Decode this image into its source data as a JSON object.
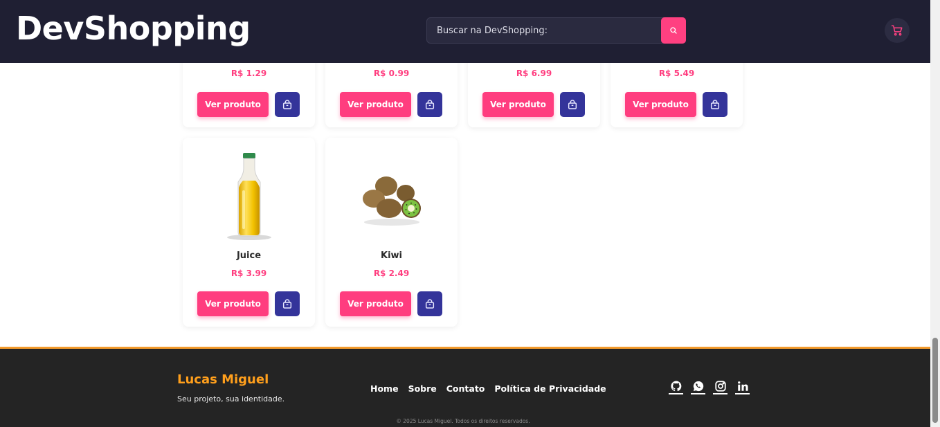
{
  "header": {
    "brand": "DevShopping",
    "search_placeholder": "Buscar na DevShopping:",
    "colors": {
      "bg": "#1f1f33",
      "accent": "#ff4081"
    }
  },
  "products_top_row": [
    {
      "price": "R$ 1.29",
      "view_label": "Ver produto"
    },
    {
      "price": "R$ 0.99",
      "view_label": "Ver produto"
    },
    {
      "price": "R$ 6.99",
      "view_label": "Ver produto"
    },
    {
      "price": "R$ 5.49",
      "view_label": "Ver produto"
    }
  ],
  "products": [
    {
      "name": "Juice",
      "price": "R$ 3.99",
      "view_label": "Ver produto",
      "image": "juice-bottle"
    },
    {
      "name": "Kiwi",
      "price": "R$ 2.49",
      "view_label": "Ver produto",
      "image": "kiwi-fruits"
    }
  ],
  "footer": {
    "name": "Lucas Miguel",
    "tagline": "Seu projeto, sua identidade.",
    "nav": [
      "Home",
      "Sobre",
      "Contato",
      "Política de Privacidade"
    ],
    "social": [
      "github-icon",
      "whatsapp-icon",
      "instagram-icon",
      "linkedin-icon"
    ],
    "copyright": "© 2025 Lucas Miguel. Todos os direitos reservados.",
    "colors": {
      "bg": "#242424",
      "name": "#ff9f1c",
      "border": "#f39a2c"
    }
  }
}
